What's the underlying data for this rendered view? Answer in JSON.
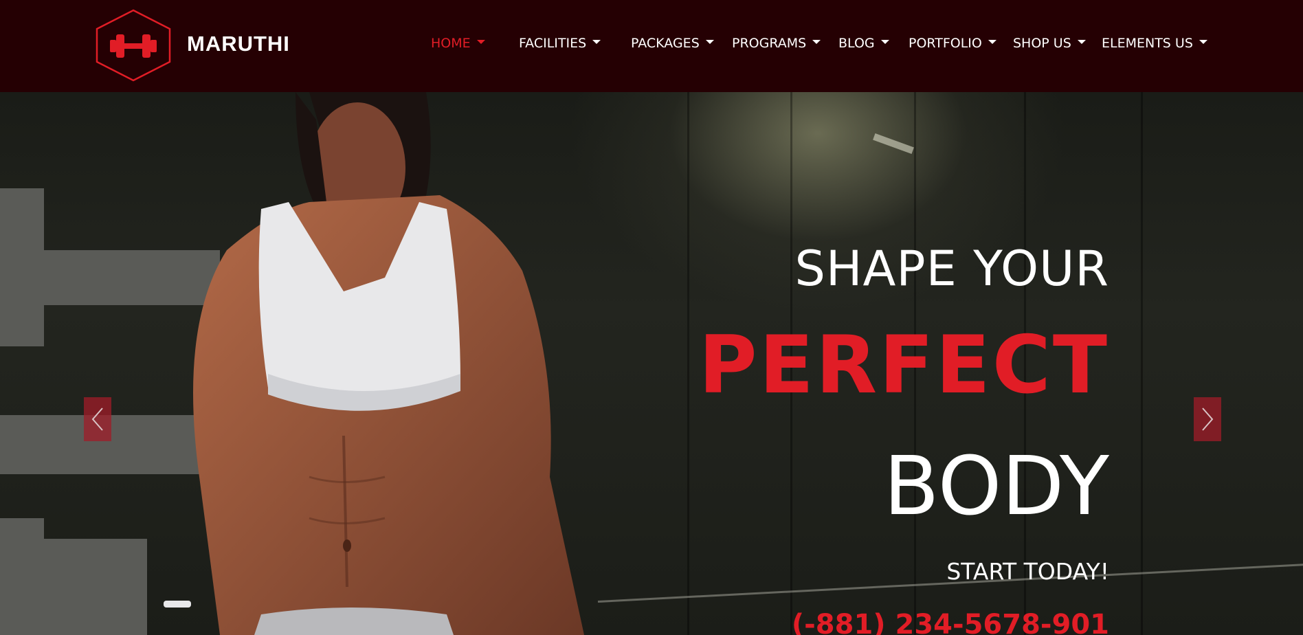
{
  "brand": {
    "name": "MARUTHI"
  },
  "nav": {
    "items": [
      {
        "label": "HOME",
        "active": true
      },
      {
        "label": "FACILITIES",
        "active": false
      },
      {
        "label": "PACKAGES",
        "active": false
      },
      {
        "label": "PROGRAMS",
        "active": false
      },
      {
        "label": "BLOG",
        "active": false
      },
      {
        "label": "PORTFOLIO",
        "active": false
      },
      {
        "label": "SHOP US",
        "active": false
      },
      {
        "label": "ELEMENTS US",
        "active": false
      }
    ]
  },
  "hero": {
    "line1": "SHAPE YOUR",
    "line2": "PERFECT",
    "line3": "BODY",
    "line4": "START TODAY!",
    "phone": "(-881) 234-5678-901"
  },
  "icons": {
    "logo": "dumbbell-hexagon-icon",
    "prev": "chevron-left-icon",
    "next": "chevron-right-icon",
    "dropdown": "caret-down-icon"
  },
  "colors": {
    "accent": "#e11d26",
    "header_bg": "#250003"
  }
}
